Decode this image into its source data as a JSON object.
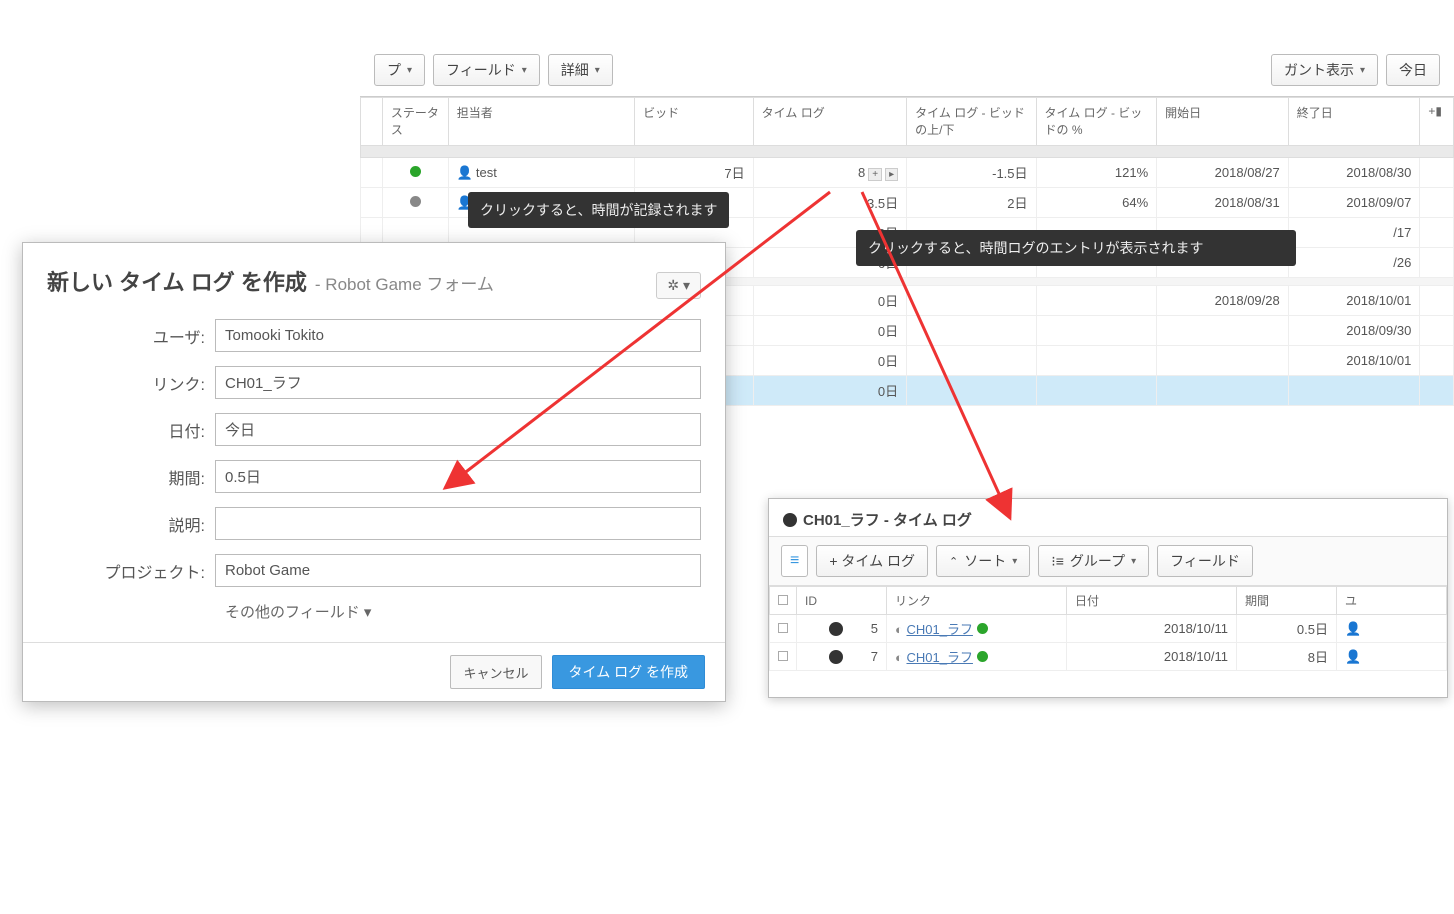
{
  "toolbar": {
    "group": "プ",
    "field": "フィールド",
    "detail": "詳細",
    "gantt": "ガント表示",
    "today": "今日"
  },
  "columns": {
    "status": "ステータス",
    "assignee": "担当者",
    "bid": "ビッド",
    "timelog": "タイム ログ",
    "timelog_diff": "タイム ログ - ビッドの上/下",
    "timelog_pct": "タイム ログ - ビッドの %",
    "start": "開始日",
    "end": "終了日"
  },
  "rows": [
    {
      "status": "green",
      "assignee": "test",
      "bid": "7日",
      "timelog": "8",
      "diff": "-1.5日",
      "diff_class": "neg",
      "pct": "121%",
      "pct_class": "neg",
      "start": "2018/08/27",
      "end": "2018/08/30"
    },
    {
      "status": "grey",
      "assignee": "",
      "bid": "",
      "timelog": "3.5日",
      "diff": "2日",
      "diff_class": "pos",
      "pct": "64%",
      "pct_class": "",
      "start": "2018/08/31",
      "end": "2018/09/07"
    },
    {
      "status": "",
      "assignee": "",
      "bid": "",
      "timelog": "3日",
      "diff": "",
      "diff_class": "",
      "pct": "",
      "pct_class": "",
      "start": "",
      "end": "/17"
    },
    {
      "status": "",
      "assignee": "",
      "bid": "",
      "timelog": "6日",
      "diff": "",
      "diff_class": "",
      "pct": "",
      "pct_class": "",
      "start": "",
      "end": "/26"
    }
  ],
  "rows2": [
    {
      "timelog": "0日",
      "start": "2018/09/28",
      "end": "2018/10/01"
    },
    {
      "timelog": "0日",
      "start": "",
      "end": "2018/09/30"
    },
    {
      "timelog": "0日",
      "start": "",
      "end": "2018/10/01"
    },
    {
      "timelog": "0日",
      "start": "",
      "end": ""
    }
  ],
  "tooltip1": "クリックすると、時間が記録されます",
  "tooltip2": "クリックすると、時間ログのエントリが表示されます",
  "modal": {
    "title": "新しい タイム ログ を作成",
    "subtitle": "- Robot Game フォーム",
    "labels": {
      "user": "ユーザ:",
      "link": "リンク:",
      "date": "日付:",
      "duration": "期間:",
      "desc": "説明:",
      "project": "プロジェクト:"
    },
    "values": {
      "user": "Tomooki Tokito",
      "link": "CH01_ラフ",
      "date": "今日",
      "duration": "0.5日",
      "desc": "",
      "project": "Robot Game"
    },
    "more": "その他のフィールド ▾",
    "cancel": "キャンセル",
    "submit": "タイム ログ を作成"
  },
  "subpanel": {
    "title": "CH01_ラフ - タイム ログ",
    "toolbar": {
      "add": "+ タイム ログ",
      "sort": "ソート",
      "group": "グループ",
      "field": "フィールド"
    },
    "columns": {
      "id": "ID",
      "link": "リンク",
      "date": "日付",
      "duration": "期間",
      "extra": "ユ"
    },
    "rows": [
      {
        "id": "5",
        "link": "CH01_ラフ",
        "date": "2018/10/11",
        "duration": "0.5日"
      },
      {
        "id": "7",
        "link": "CH01_ラフ",
        "date": "2018/10/11",
        "duration": "8日"
      }
    ]
  }
}
